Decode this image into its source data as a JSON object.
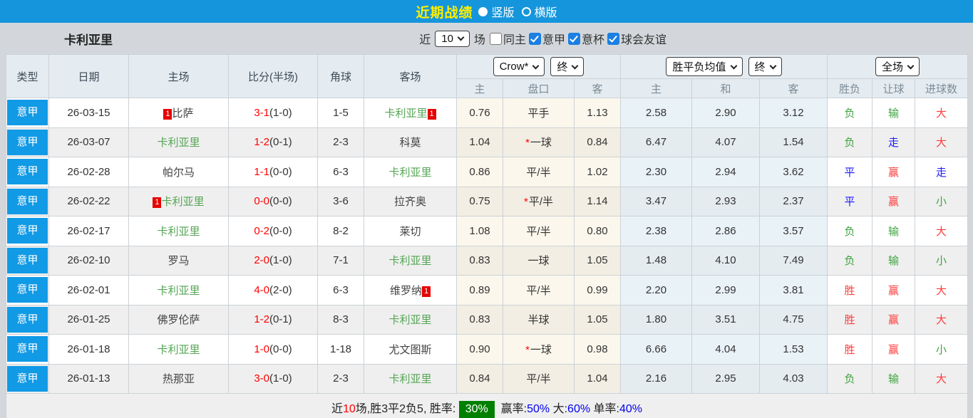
{
  "topbar": {
    "title": "近期战绩",
    "radios": [
      {
        "label": "竖版",
        "selected": true
      },
      {
        "label": "横版",
        "selected": false
      }
    ]
  },
  "filterbar": {
    "team": "卡利亚里",
    "near_label": "近",
    "near_value": "10",
    "games_label": "场",
    "checkboxes": [
      {
        "label": "同主",
        "checked": false
      },
      {
        "label": "意甲",
        "checked": true
      },
      {
        "label": "意杯",
        "checked": true
      },
      {
        "label": "球会友谊",
        "checked": true
      }
    ]
  },
  "table": {
    "main_headers": [
      "类型",
      "日期",
      "主场",
      "比分(半场)",
      "角球",
      "客场"
    ],
    "selects": {
      "crow_book": "Crow*",
      "crow_time": "终",
      "avg_book": "胜平负均值",
      "avg_time": "终",
      "full_scope": "全场"
    },
    "sub_headers": [
      "主",
      "盘口",
      "客",
      "主",
      "和",
      "客",
      "胜负",
      "让球",
      "进球数"
    ],
    "rows": [
      {
        "league": "意甲",
        "date": "26-03-15",
        "home": {
          "name": "比萨",
          "green": false,
          "badge": "1",
          "badge_pos": "before"
        },
        "score": {
          "ft": "3-1",
          "ht": "(1-0)"
        },
        "corners": "1-5",
        "away": {
          "name": "卡利亚里",
          "green": true,
          "badge": "1",
          "badge_pos": "after"
        },
        "crow": {
          "home": "0.76",
          "star": false,
          "handicap": "平手",
          "away": "1.13"
        },
        "avg": {
          "home": "2.58",
          "draw": "2.90",
          "away": "3.12"
        },
        "results": {
          "wdl": {
            "text": "负",
            "color": "green"
          },
          "handicap": {
            "text": "输",
            "color": "green"
          },
          "goals": {
            "text": "大",
            "color": "red"
          }
        }
      },
      {
        "league": "意甲",
        "date": "26-03-07",
        "home": {
          "name": "卡利亚里",
          "green": true,
          "badge": "",
          "badge_pos": ""
        },
        "score": {
          "ft": "1-2",
          "ht": "(0-1)"
        },
        "corners": "2-3",
        "away": {
          "name": "科莫",
          "green": false,
          "badge": "",
          "badge_pos": ""
        },
        "crow": {
          "home": "1.04",
          "star": true,
          "handicap": "一球",
          "away": "0.84"
        },
        "avg": {
          "home": "6.47",
          "draw": "4.07",
          "away": "1.54"
        },
        "results": {
          "wdl": {
            "text": "负",
            "color": "green"
          },
          "handicap": {
            "text": "走",
            "color": "blue"
          },
          "goals": {
            "text": "大",
            "color": "red"
          }
        }
      },
      {
        "league": "意甲",
        "date": "26-02-28",
        "home": {
          "name": "帕尔马",
          "green": false,
          "badge": "",
          "badge_pos": ""
        },
        "score": {
          "ft": "1-1",
          "ht": "(0-0)"
        },
        "corners": "6-3",
        "away": {
          "name": "卡利亚里",
          "green": true,
          "badge": "",
          "badge_pos": ""
        },
        "crow": {
          "home": "0.86",
          "star": false,
          "handicap": "平/半",
          "away": "1.02"
        },
        "avg": {
          "home": "2.30",
          "draw": "2.94",
          "away": "3.62"
        },
        "results": {
          "wdl": {
            "text": "平",
            "color": "blue"
          },
          "handicap": {
            "text": "赢",
            "color": "red"
          },
          "goals": {
            "text": "走",
            "color": "blue"
          }
        }
      },
      {
        "league": "意甲",
        "date": "26-02-22",
        "home": {
          "name": "卡利亚里",
          "green": true,
          "badge": "1",
          "badge_pos": "before"
        },
        "score": {
          "ft": "0-0",
          "ht": "(0-0)"
        },
        "corners": "3-6",
        "away": {
          "name": "拉齐奥",
          "green": false,
          "badge": "",
          "badge_pos": ""
        },
        "crow": {
          "home": "0.75",
          "star": true,
          "handicap": "平/半",
          "away": "1.14"
        },
        "avg": {
          "home": "3.47",
          "draw": "2.93",
          "away": "2.37"
        },
        "results": {
          "wdl": {
            "text": "平",
            "color": "blue"
          },
          "handicap": {
            "text": "赢",
            "color": "red"
          },
          "goals": {
            "text": "小",
            "color": "green"
          }
        }
      },
      {
        "league": "意甲",
        "date": "26-02-17",
        "home": {
          "name": "卡利亚里",
          "green": true,
          "badge": "",
          "badge_pos": ""
        },
        "score": {
          "ft": "0-2",
          "ht": "(0-0)"
        },
        "corners": "8-2",
        "away": {
          "name": "莱切",
          "green": false,
          "badge": "",
          "badge_pos": ""
        },
        "crow": {
          "home": "1.08",
          "star": false,
          "handicap": "平/半",
          "away": "0.80"
        },
        "avg": {
          "home": "2.38",
          "draw": "2.86",
          "away": "3.57"
        },
        "results": {
          "wdl": {
            "text": "负",
            "color": "green"
          },
          "handicap": {
            "text": "输",
            "color": "green"
          },
          "goals": {
            "text": "大",
            "color": "red"
          }
        }
      },
      {
        "league": "意甲",
        "date": "26-02-10",
        "home": {
          "name": "罗马",
          "green": false,
          "badge": "",
          "badge_pos": ""
        },
        "score": {
          "ft": "2-0",
          "ht": "(1-0)"
        },
        "corners": "7-1",
        "away": {
          "name": "卡利亚里",
          "green": true,
          "badge": "",
          "badge_pos": ""
        },
        "crow": {
          "home": "0.83",
          "star": false,
          "handicap": "一球",
          "away": "1.05"
        },
        "avg": {
          "home": "1.48",
          "draw": "4.10",
          "away": "7.49"
        },
        "results": {
          "wdl": {
            "text": "负",
            "color": "green"
          },
          "handicap": {
            "text": "输",
            "color": "green"
          },
          "goals": {
            "text": "小",
            "color": "green"
          }
        }
      },
      {
        "league": "意甲",
        "date": "26-02-01",
        "home": {
          "name": "卡利亚里",
          "green": true,
          "badge": "",
          "badge_pos": ""
        },
        "score": {
          "ft": "4-0",
          "ht": "(2-0)"
        },
        "corners": "6-3",
        "away": {
          "name": "维罗纳",
          "green": false,
          "badge": "1",
          "badge_pos": "after"
        },
        "crow": {
          "home": "0.89",
          "star": false,
          "handicap": "平/半",
          "away": "0.99"
        },
        "avg": {
          "home": "2.20",
          "draw": "2.99",
          "away": "3.81"
        },
        "results": {
          "wdl": {
            "text": "胜",
            "color": "red"
          },
          "handicap": {
            "text": "赢",
            "color": "red"
          },
          "goals": {
            "text": "大",
            "color": "red"
          }
        }
      },
      {
        "league": "意甲",
        "date": "26-01-25",
        "home": {
          "name": "佛罗伦萨",
          "green": false,
          "badge": "",
          "badge_pos": ""
        },
        "score": {
          "ft": "1-2",
          "ht": "(0-1)"
        },
        "corners": "8-3",
        "away": {
          "name": "卡利亚里",
          "green": true,
          "badge": "",
          "badge_pos": ""
        },
        "crow": {
          "home": "0.83",
          "star": false,
          "handicap": "半球",
          "away": "1.05"
        },
        "avg": {
          "home": "1.80",
          "draw": "3.51",
          "away": "4.75"
        },
        "results": {
          "wdl": {
            "text": "胜",
            "color": "red"
          },
          "handicap": {
            "text": "赢",
            "color": "red"
          },
          "goals": {
            "text": "大",
            "color": "red"
          }
        }
      },
      {
        "league": "意甲",
        "date": "26-01-18",
        "home": {
          "name": "卡利亚里",
          "green": true,
          "badge": "",
          "badge_pos": ""
        },
        "score": {
          "ft": "1-0",
          "ht": "(0-0)"
        },
        "corners": "1-18",
        "away": {
          "name": "尤文图斯",
          "green": false,
          "badge": "",
          "badge_pos": ""
        },
        "crow": {
          "home": "0.90",
          "star": true,
          "handicap": "一球",
          "away": "0.98"
        },
        "avg": {
          "home": "6.66",
          "draw": "4.04",
          "away": "1.53"
        },
        "results": {
          "wdl": {
            "text": "胜",
            "color": "red"
          },
          "handicap": {
            "text": "赢",
            "color": "red"
          },
          "goals": {
            "text": "小",
            "color": "green"
          }
        }
      },
      {
        "league": "意甲",
        "date": "26-01-13",
        "home": {
          "name": "热那亚",
          "green": false,
          "badge": "",
          "badge_pos": ""
        },
        "score": {
          "ft": "3-0",
          "ht": "(1-0)"
        },
        "corners": "2-3",
        "away": {
          "name": "卡利亚里",
          "green": true,
          "badge": "",
          "badge_pos": ""
        },
        "crow": {
          "home": "0.84",
          "star": false,
          "handicap": "平/半",
          "away": "1.04"
        },
        "avg": {
          "home": "2.16",
          "draw": "2.95",
          "away": "4.03"
        },
        "results": {
          "wdl": {
            "text": "负",
            "color": "green"
          },
          "handicap": {
            "text": "输",
            "color": "green"
          },
          "goals": {
            "text": "大",
            "color": "red"
          }
        }
      }
    ],
    "summary_segments": [
      {
        "text": "近",
        "style": "black"
      },
      {
        "text": "10",
        "style": "red"
      },
      {
        "text": "场,胜3平2负5, 胜率: ",
        "style": "black"
      },
      {
        "text": "30%",
        "style": "badge"
      },
      {
        "text": "  赢率:",
        "style": "black"
      },
      {
        "text": "50%",
        "style": "blue"
      },
      {
        "text": " 大:",
        "style": "black"
      },
      {
        "text": "60%",
        "style": "blue"
      },
      {
        "text": " 单率:",
        "style": "black"
      },
      {
        "text": "40%",
        "style": "blue"
      }
    ]
  },
  "colors": {
    "topbar_blue": "#1596dc",
    "league_cell_blue": "#119ae6",
    "title_yellow": "#ffee00",
    "team_green": "#55a555",
    "score_red": "#ff0000",
    "result_red": "#ff3b3b",
    "result_blue": "#1a1aff",
    "result_green": "#3fa33f",
    "win_rate_badge_green": "#008000",
    "checkbox_blue": "#1b7fe4"
  }
}
